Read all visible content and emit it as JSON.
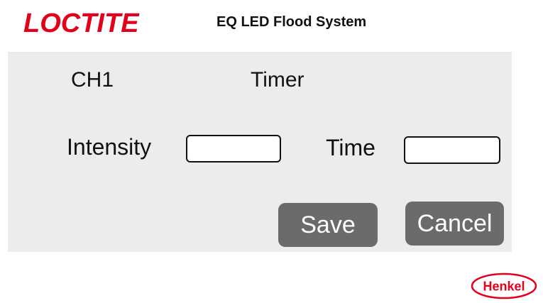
{
  "header": {
    "brand": "LOCTITE",
    "title": "EQ LED Flood System"
  },
  "panel": {
    "channel": "CH1",
    "mode": "Timer",
    "intensity_label": "Intensity",
    "intensity_value": "",
    "time_label": "Time",
    "time_value": "",
    "save_label": "Save",
    "cancel_label": "Cancel"
  },
  "footer": {
    "brand": "Henkel"
  },
  "colors": {
    "brand_red": "#e2001a",
    "panel_bg": "#ececec",
    "button_bg": "#6b6b6b",
    "button_text": "#ffffff"
  },
  "icons": {
    "brand_logo": "loctite-logo",
    "footer_logo": "henkel-logo"
  }
}
